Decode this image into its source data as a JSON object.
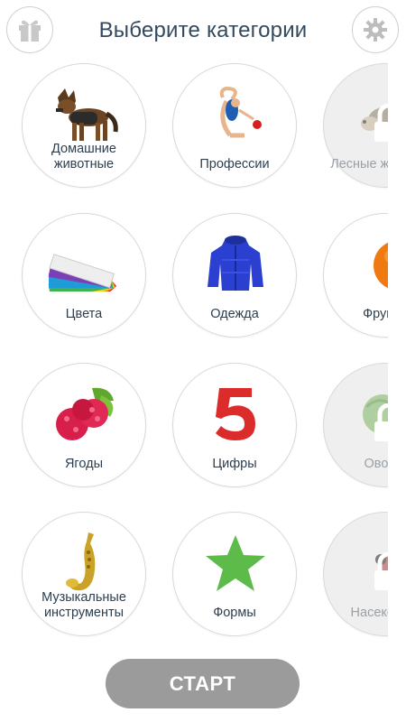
{
  "header": {
    "title": "Выберите категории",
    "gift_icon": "gift-icon",
    "settings_icon": "gear-icon"
  },
  "categories": [
    {
      "label": "Домашние животные",
      "icon": "dog",
      "locked": false
    },
    {
      "label": "Профессии",
      "icon": "gymnast",
      "locked": false
    },
    {
      "label": "Лесные животные",
      "icon": "hedgehog",
      "locked": true
    },
    {
      "label": "Цвета",
      "icon": "color-fan",
      "locked": false
    },
    {
      "label": "Одежда",
      "icon": "jacket",
      "locked": false
    },
    {
      "label": "Фрукты",
      "icon": "orange",
      "locked": false
    },
    {
      "label": "Ягоды",
      "icon": "raspberry",
      "locked": false
    },
    {
      "label": "Цифры",
      "icon": "number-five",
      "locked": false
    },
    {
      "label": "Овощи",
      "icon": "cabbage",
      "locked": true
    },
    {
      "label": "Музыкальные инструменты",
      "icon": "saxophone",
      "locked": false
    },
    {
      "label": "Формы",
      "icon": "star",
      "locked": false
    },
    {
      "label": "Насекомые",
      "icon": "ladybug",
      "locked": true
    }
  ],
  "footer": {
    "start_label": "СТАРТ"
  },
  "colors": {
    "title": "#34495e",
    "start_button": "#9b9b9b",
    "tile_border": "#d9d9d9",
    "locked_tile": "#efefef"
  }
}
